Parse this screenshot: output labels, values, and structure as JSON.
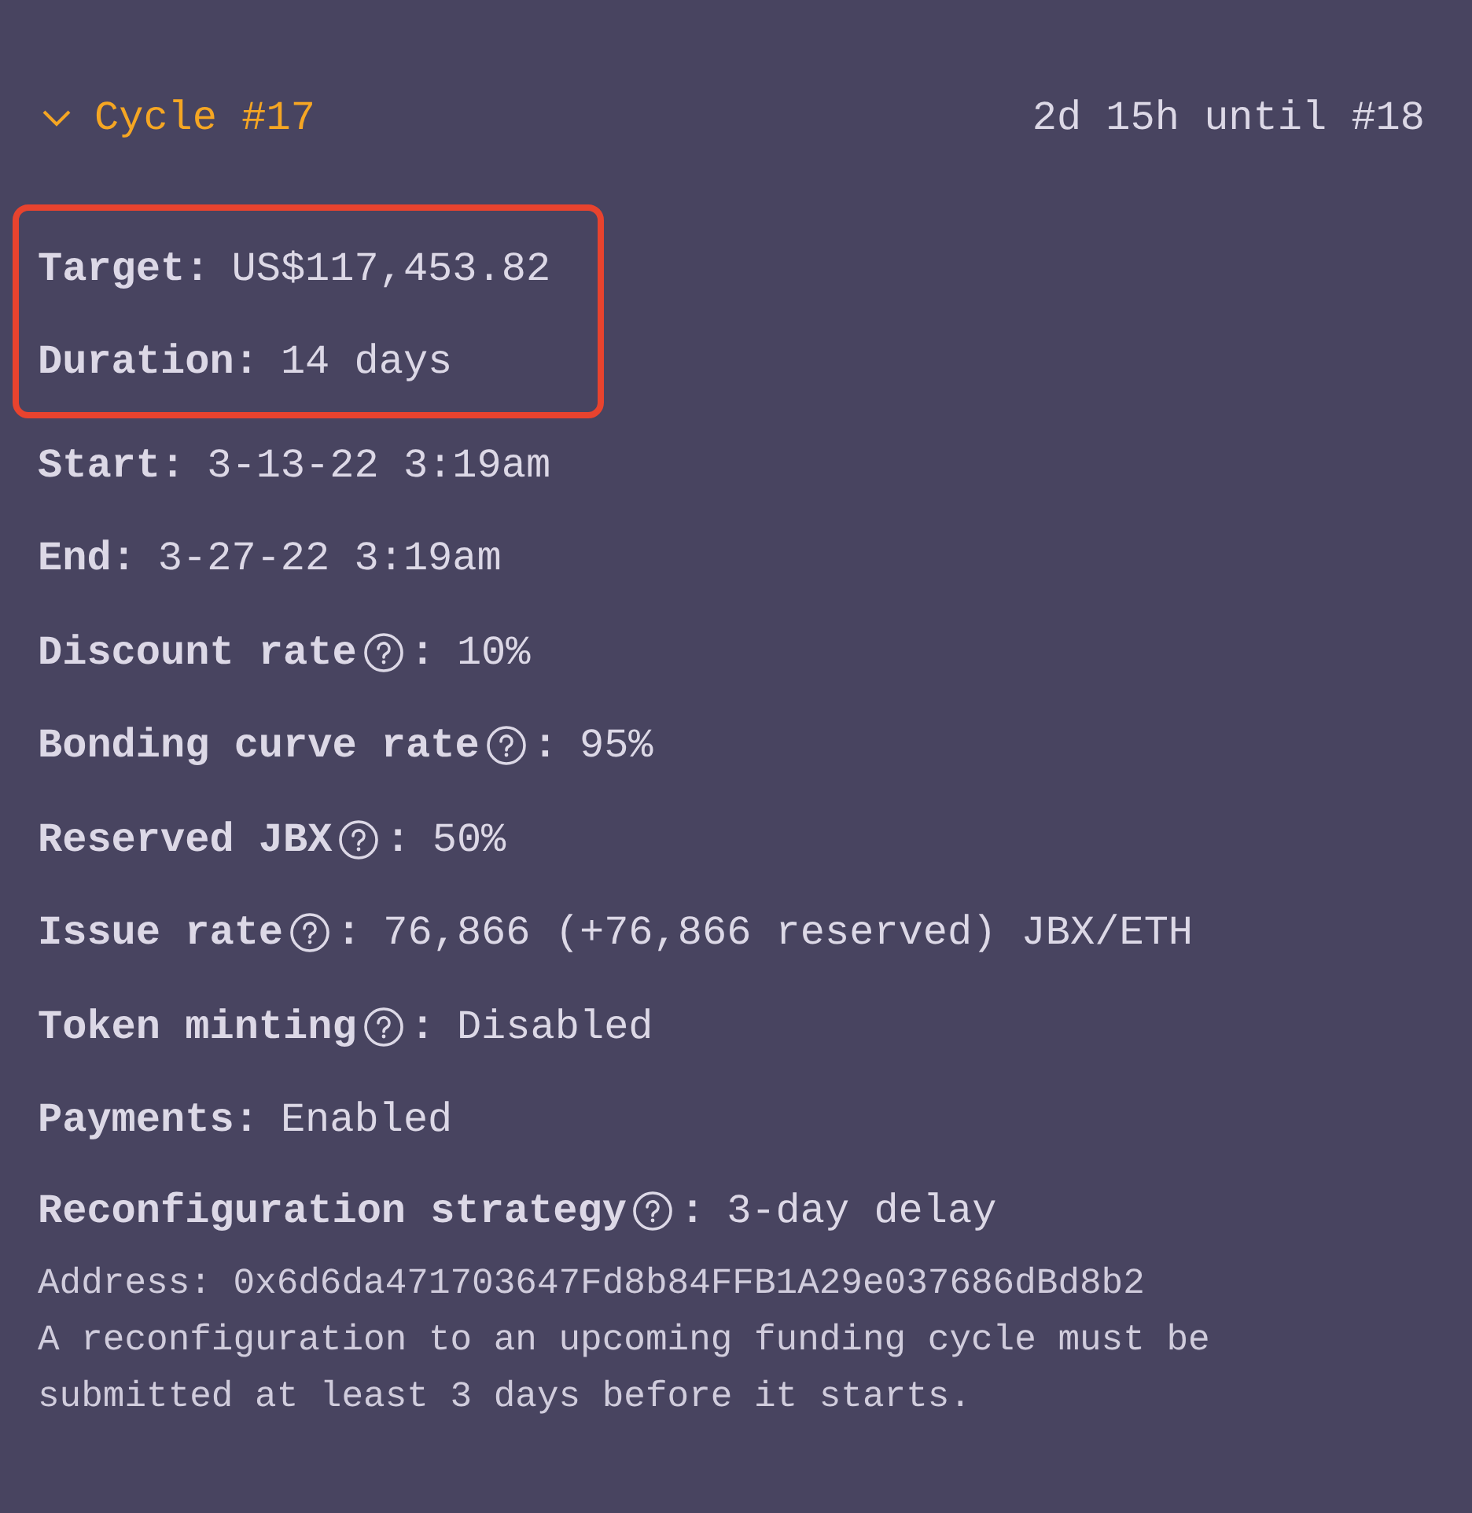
{
  "header": {
    "expanded": true,
    "title": "Cycle #17",
    "countdown": "2d 15h until #18"
  },
  "rows": [
    {
      "label": "Target",
      "help": false,
      "colon": ":",
      "value": "US$117,453.82",
      "highlighted": true
    },
    {
      "label": "Duration",
      "help": false,
      "colon": ":",
      "value": "14 days",
      "highlighted": true
    },
    {
      "label": "Start",
      "help": false,
      "colon": ":",
      "value": "3-13-22 3:19am",
      "highlighted": false
    },
    {
      "label": "End",
      "help": false,
      "colon": ":",
      "value": "3-27-22 3:19am",
      "highlighted": false
    },
    {
      "label": "Discount rate",
      "help": true,
      "colon": ":",
      "value": "10%",
      "highlighted": false
    },
    {
      "label": "Bonding curve rate",
      "help": true,
      "colon": ":",
      "value": "95%",
      "highlighted": false
    },
    {
      "label": "Reserved JBX",
      "help": true,
      "colon": ":",
      "value": "50%",
      "highlighted": false
    },
    {
      "label": "Issue rate",
      "help": true,
      "colon": ":",
      "value": "76,866 (+76,866 reserved) JBX/ETH",
      "highlighted": false
    },
    {
      "label": "Token minting",
      "help": true,
      "colon": ":",
      "value": "Disabled",
      "highlighted": false
    },
    {
      "label": "Payments",
      "help": false,
      "colon": ":",
      "value": "Enabled",
      "highlighted": false
    }
  ],
  "reconfiguration": {
    "label": "Reconfiguration strategy",
    "help": true,
    "colon": ":",
    "value": "3-day delay",
    "address": "Address: 0x6d6da471703647Fd8b84FFB1A29e037686dBd8b2",
    "description": "A reconfiguration to an upcoming funding cycle must be submitted at least 3 days before it starts."
  }
}
